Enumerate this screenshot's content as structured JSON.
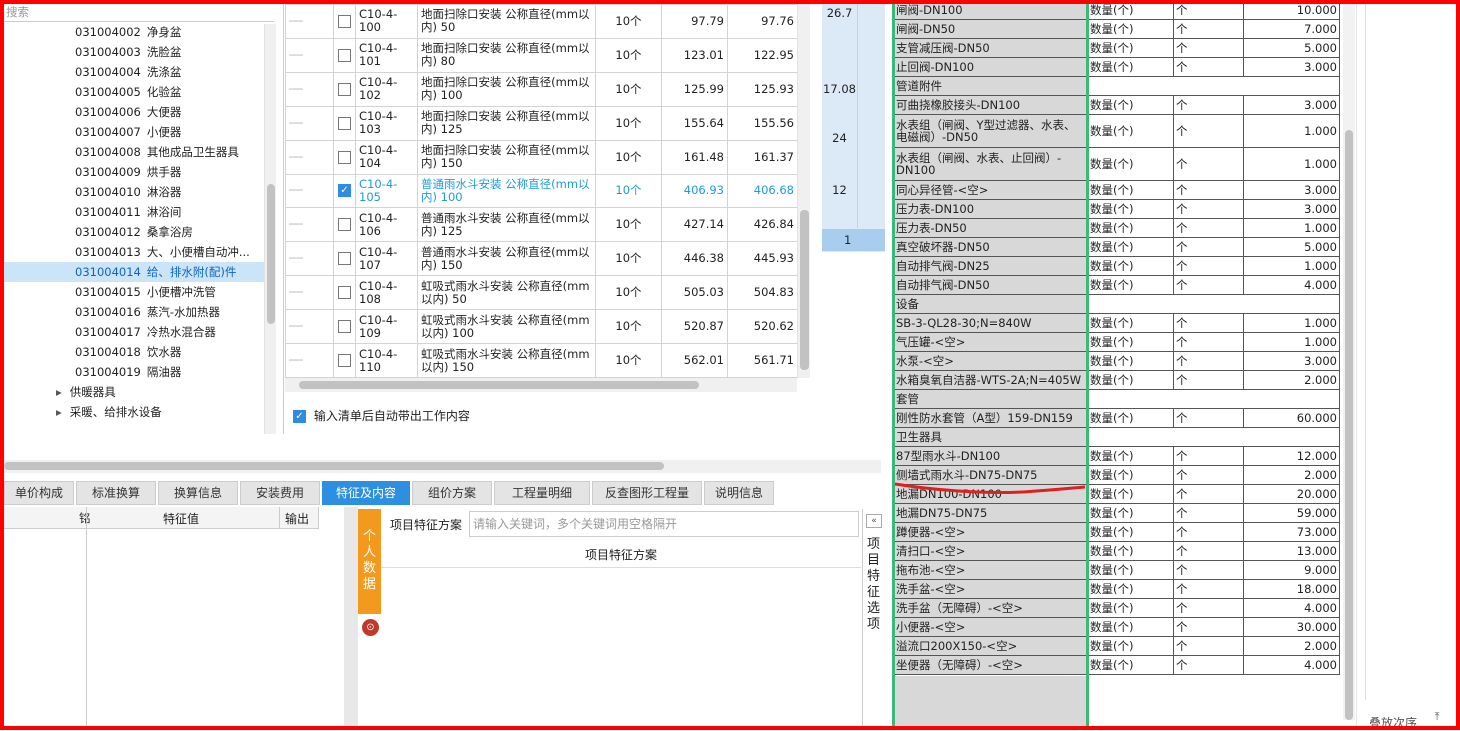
{
  "tree": {
    "search_placeholder": "搜索",
    "items": [
      {
        "code": "031004002",
        "name": "净身盆"
      },
      {
        "code": "031004003",
        "name": "洗脸盆"
      },
      {
        "code": "031004004",
        "name": "洗涤盆"
      },
      {
        "code": "031004005",
        "name": "化验盆"
      },
      {
        "code": "031004006",
        "name": "大便器"
      },
      {
        "code": "031004007",
        "name": "小便器"
      },
      {
        "code": "031004008",
        "name": "其他成品卫生器具"
      },
      {
        "code": "031004009",
        "name": "烘手器"
      },
      {
        "code": "031004010",
        "name": "淋浴器"
      },
      {
        "code": "031004011",
        "name": "淋浴间"
      },
      {
        "code": "031004012",
        "name": "桑拿浴房"
      },
      {
        "code": "031004013",
        "name": "大、小便槽自动冲..."
      },
      {
        "code": "031004014",
        "name": "给、排水附(配)件"
      },
      {
        "code": "031004015",
        "name": "小便槽冲洗管"
      },
      {
        "code": "031004016",
        "name": "蒸汽-水加热器"
      },
      {
        "code": "031004017",
        "name": "冷热水混合器"
      },
      {
        "code": "031004018",
        "name": "饮水器"
      },
      {
        "code": "031004019",
        "name": "隔油器"
      }
    ],
    "groups": [
      "供暖器具",
      "采暖、给排水设备"
    ]
  },
  "quota": {
    "rows": [
      {
        "code": "C10-4-100",
        "name": "地面扫除口安装 公称直径(mm以内) 50",
        "unit": "10个",
        "p1": "97.79",
        "p2": "97.76",
        "checked": false
      },
      {
        "code": "C10-4-101",
        "name": "地面扫除口安装 公称直径(mm以内) 80",
        "unit": "10个",
        "p1": "123.01",
        "p2": "122.95",
        "checked": false
      },
      {
        "code": "C10-4-102",
        "name": "地面扫除口安装 公称直径(mm以内) 100",
        "unit": "10个",
        "p1": "125.99",
        "p2": "125.93",
        "checked": false
      },
      {
        "code": "C10-4-103",
        "name": "地面扫除口安装 公称直径(mm以内) 125",
        "unit": "10个",
        "p1": "155.64",
        "p2": "155.56",
        "checked": false
      },
      {
        "code": "C10-4-104",
        "name": "地面扫除口安装 公称直径(mm以内) 150",
        "unit": "10个",
        "p1": "161.48",
        "p2": "161.37",
        "checked": false
      },
      {
        "code": "C10-4-105",
        "name": "普通雨水斗安装 公称直径(mm以内) 100",
        "unit": "10个",
        "p1": "406.93",
        "p2": "406.68",
        "checked": true
      },
      {
        "code": "C10-4-106",
        "name": "普通雨水斗安装 公称直径(mm以内) 125",
        "unit": "10个",
        "p1": "427.14",
        "p2": "426.84",
        "checked": false
      },
      {
        "code": "C10-4-107",
        "name": "普通雨水斗安装 公称直径(mm以内) 150",
        "unit": "10个",
        "p1": "446.38",
        "p2": "445.93",
        "checked": false
      },
      {
        "code": "C10-4-108",
        "name": "虹吸式雨水斗安装 公称直径(mm以内) 50",
        "unit": "10个",
        "p1": "505.03",
        "p2": "504.83",
        "checked": false
      },
      {
        "code": "C10-4-109",
        "name": "虹吸式雨水斗安装 公称直径(mm以内) 100",
        "unit": "10个",
        "p1": "520.87",
        "p2": "520.62",
        "checked": false
      },
      {
        "code": "C10-4-110",
        "name": "虹吸式雨水斗安装 公称直径(mm以内) 150",
        "unit": "10个",
        "p1": "562.01",
        "p2": "561.71",
        "checked": false
      }
    ],
    "auto_label": "输入清单后自动带出工作内容"
  },
  "side_numbers": [
    "26.7",
    "17.08",
    "24",
    "12",
    "1"
  ],
  "tabs": [
    "单价构成",
    "标准换算",
    "换算信息",
    "安装费用",
    "特征及内容",
    "组价方案",
    "工程量明细",
    "反查图形工程量",
    "说明信息"
  ],
  "feature": {
    "col_value": "特征值",
    "col_output": "输出",
    "col_small": "铭"
  },
  "personal": {
    "label": "个人数据",
    "scheme_label": "项目特征方案",
    "search_placeholder": "请输入关键词，多个关键词用空格隔开",
    "header": "项目特征方案",
    "side_label": "项目特征选项"
  },
  "bottom_right": "叠放次序",
  "boq": [
    {
      "t": "r",
      "name": "闸阀-DN100",
      "unit": "数量(个)",
      "u": "个",
      "v": "10.000"
    },
    {
      "t": "r",
      "name": "闸阀-DN50",
      "unit": "数量(个)",
      "u": "个",
      "v": "7.000"
    },
    {
      "t": "r",
      "name": "支管减压阀-DN50",
      "unit": "数量(个)",
      "u": "个",
      "v": "5.000"
    },
    {
      "t": "r",
      "name": "止回阀-DN100",
      "unit": "数量(个)",
      "u": "个",
      "v": "3.000"
    },
    {
      "t": "s",
      "name": "管道附件"
    },
    {
      "t": "r",
      "name": "可曲挠橡胶接头-DN100",
      "unit": "数量(个)",
      "u": "个",
      "v": "3.000"
    },
    {
      "t": "t",
      "name": "水表组（闸阀、Y型过滤器、水表、电磁阀）-DN50",
      "unit": "数量(个)",
      "u": "个",
      "v": "1.000"
    },
    {
      "t": "t",
      "name": "水表组（闸阀、水表、止回阀）-DN100",
      "unit": "数量(个)",
      "u": "个",
      "v": "1.000"
    },
    {
      "t": "r",
      "name": "同心异径管-<空>",
      "unit": "数量(个)",
      "u": "个",
      "v": "3.000"
    },
    {
      "t": "r",
      "name": "压力表-DN100",
      "unit": "数量(个)",
      "u": "个",
      "v": "3.000"
    },
    {
      "t": "r",
      "name": "压力表-DN50",
      "unit": "数量(个)",
      "u": "个",
      "v": "1.000"
    },
    {
      "t": "r",
      "name": "真空破坏器-DN50",
      "unit": "数量(个)",
      "u": "个",
      "v": "5.000"
    },
    {
      "t": "r",
      "name": "自动排气阀-DN25",
      "unit": "数量(个)",
      "u": "个",
      "v": "1.000"
    },
    {
      "t": "r",
      "name": "自动排气阀-DN50",
      "unit": "数量(个)",
      "u": "个",
      "v": "4.000"
    },
    {
      "t": "s",
      "name": "设备"
    },
    {
      "t": "r",
      "name": "SB-3-QL28-30;N=840W",
      "unit": "数量(个)",
      "u": "个",
      "v": "1.000"
    },
    {
      "t": "r",
      "name": "气压罐-<空>",
      "unit": "数量(个)",
      "u": "个",
      "v": "1.000"
    },
    {
      "t": "r",
      "name": "水泵-<空>",
      "unit": "数量(个)",
      "u": "个",
      "v": "3.000"
    },
    {
      "t": "r",
      "name": "水箱臭氧自洁器-WTS-2A;N=405W",
      "unit": "数量(个)",
      "u": "个",
      "v": "2.000"
    },
    {
      "t": "s",
      "name": "套管"
    },
    {
      "t": "r",
      "name": "刚性防水套管（A型）159-DN159",
      "unit": "数量(个)",
      "u": "个",
      "v": "60.000"
    },
    {
      "t": "s",
      "name": "卫生器具"
    },
    {
      "t": "r",
      "name": "87型雨水斗-DN100",
      "unit": "数量(个)",
      "u": "个",
      "v": "12.000"
    },
    {
      "t": "r",
      "name": "侧墙式雨水斗-DN75-DN75",
      "unit": "数量(个)",
      "u": "个",
      "v": "2.000"
    },
    {
      "t": "r",
      "name": "地漏DN100-DN100",
      "unit": "数量(个)",
      "u": "个",
      "v": "20.000"
    },
    {
      "t": "r",
      "name": "地漏DN75-DN75",
      "unit": "数量(个)",
      "u": "个",
      "v": "59.000"
    },
    {
      "t": "r",
      "name": "蹲便器-<空>",
      "unit": "数量(个)",
      "u": "个",
      "v": "73.000"
    },
    {
      "t": "r",
      "name": "清扫口-<空>",
      "unit": "数量(个)",
      "u": "个",
      "v": "13.000"
    },
    {
      "t": "r",
      "name": "拖布池-<空>",
      "unit": "数量(个)",
      "u": "个",
      "v": "9.000"
    },
    {
      "t": "r",
      "name": "洗手盆-<空>",
      "unit": "数量(个)",
      "u": "个",
      "v": "18.000"
    },
    {
      "t": "r",
      "name": "洗手盆（无障碍）-<空>",
      "unit": "数量(个)",
      "u": "个",
      "v": "4.000"
    },
    {
      "t": "r",
      "name": "小便器-<空>",
      "unit": "数量(个)",
      "u": "个",
      "v": "30.000"
    },
    {
      "t": "r",
      "name": "溢流口200X150-<空>",
      "unit": "数量(个)",
      "u": "个",
      "v": "2.000"
    },
    {
      "t": "r",
      "name": "坐便器（无障碍）-<空>",
      "unit": "数量(个)",
      "u": "个",
      "v": "4.000"
    }
  ]
}
